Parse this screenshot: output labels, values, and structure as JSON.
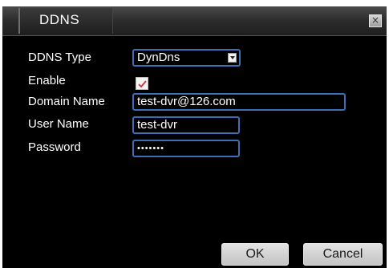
{
  "dialog": {
    "title": "DDNS",
    "close_glyph": "×"
  },
  "form": {
    "ddns_type_label": "DDNS Type",
    "ddns_type_value": "DynDns",
    "enable_label": "Enable",
    "enable_checked": true,
    "domain_name_label": "Domain Name",
    "domain_name_value": "test-dvr@126.com",
    "user_name_label": "User Name",
    "user_name_value": "test-dvr",
    "password_label": "Password",
    "password_value": "•••••••"
  },
  "buttons": {
    "ok_label": "OK",
    "cancel_label": "Cancel"
  },
  "colors": {
    "field_border": "#3c6fb8",
    "check_mark": "#d83030"
  }
}
